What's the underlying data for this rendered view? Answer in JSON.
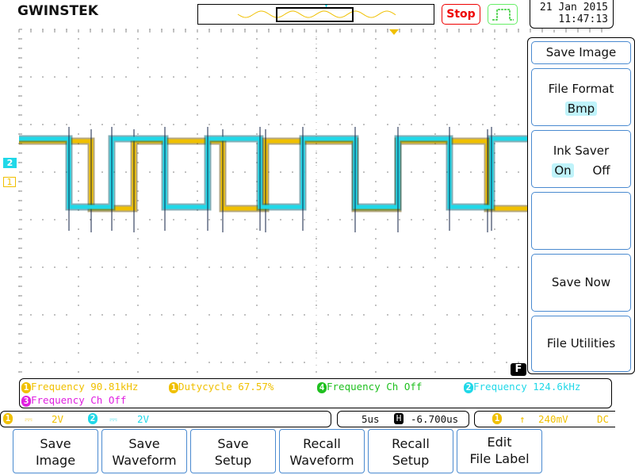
{
  "header": {
    "brand": "GWINSTEK",
    "run_state": "Stop",
    "date": "21 Jan 2015",
    "time": "11:47:13"
  },
  "colors": {
    "ch1": "#f0c000",
    "ch2": "#20d8e8",
    "ch3": "#e020e0",
    "ch4": "#20c020",
    "stop": "#e00000",
    "button_border": "#4a8ad0"
  },
  "channel_markers": {
    "ch1": "1",
    "ch2": "2"
  },
  "menu": {
    "title": "Save Image",
    "file_format": {
      "label": "File Format",
      "value": "Bmp"
    },
    "ink_saver": {
      "label": "Ink Saver",
      "on": "On",
      "off": "Off",
      "selected": "On"
    },
    "save_now": "Save Now",
    "file_utilities": "File Utilities",
    "badge": "F"
  },
  "measurements": [
    {
      "ch": "1",
      "text": "Frequency 90.81kHz"
    },
    {
      "ch": "1",
      "text": "Dutycycle 67.57%"
    },
    {
      "ch": "4",
      "text": "Frequency Ch Off"
    },
    {
      "ch": "2",
      "text": "Frequency 124.6kHz"
    },
    {
      "ch": "3",
      "text": "Frequency Ch Off"
    }
  ],
  "status": {
    "ch1_num": "1",
    "ch1_coupling": "DC",
    "ch1_scale": "2V",
    "ch2_num": "2",
    "ch2_scale": "2V",
    "timebase": "5us",
    "h_label": "H",
    "h_position": "-6.700us",
    "trig_ch": "1",
    "trig_level": "240mV",
    "trig_coupling": "DC"
  },
  "bottom_buttons": [
    {
      "line1": "Save",
      "line2": "Image"
    },
    {
      "line1": "Save",
      "line2": "Waveform"
    },
    {
      "line1": "Save",
      "line2": "Setup"
    },
    {
      "line1": "Recall",
      "line2": "Waveform"
    },
    {
      "line1": "Recall",
      "line2": "Setup"
    },
    {
      "line1": "Edit",
      "line2": "File Label"
    }
  ]
}
